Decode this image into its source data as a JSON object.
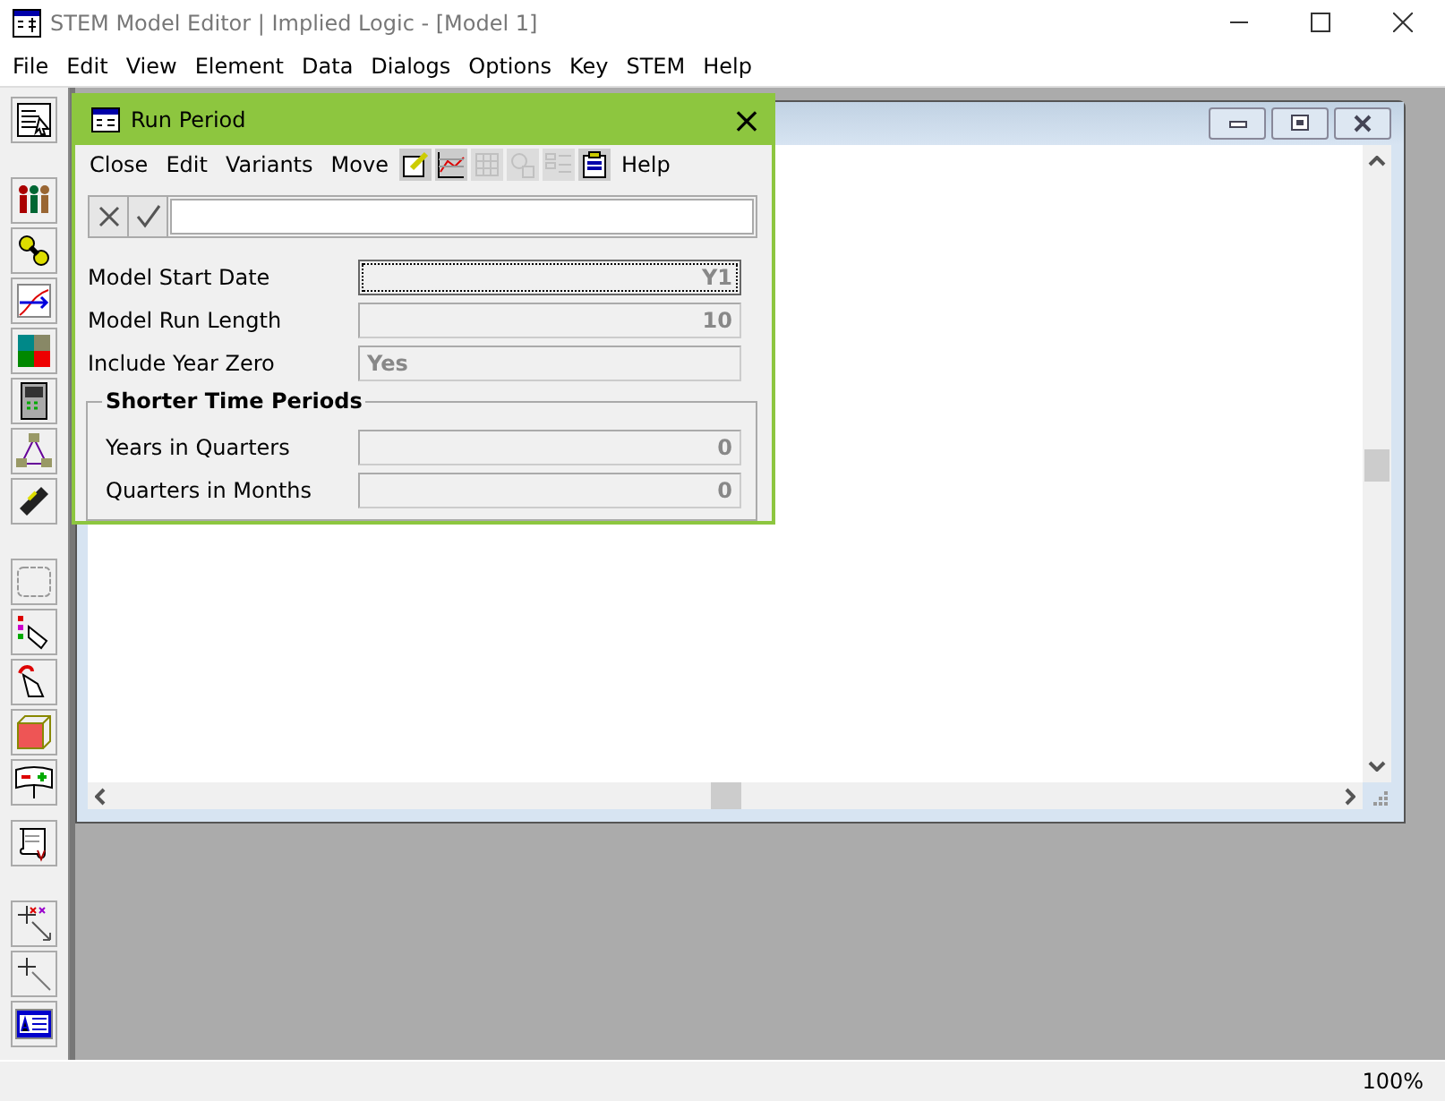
{
  "window": {
    "title": "STEM Model Editor | Implied Logic - [Model 1]"
  },
  "menu": [
    "File",
    "Edit",
    "View",
    "Element",
    "Data",
    "Dialogs",
    "Options",
    "Key",
    "STEM",
    "Help"
  ],
  "dialog": {
    "title": "Run Period",
    "close": "×",
    "menu": [
      "Close",
      "Edit",
      "Variants",
      "Move"
    ],
    "toolbar": [
      {
        "disabled": false
      },
      {
        "disabled": false
      },
      {
        "disabled": true
      },
      {
        "disabled": true
      },
      {
        "disabled": true
      },
      {
        "disabled": false
      }
    ],
    "help": "Help",
    "fields": [
      {
        "label": "Model Start Date",
        "value": "Y1",
        "kind": "number",
        "focused": true
      },
      {
        "label": "Model Run Length",
        "value": "10",
        "kind": "number",
        "focused": false
      },
      {
        "label": "Include Year Zero",
        "value": "Yes",
        "kind": "choice",
        "focused": false
      }
    ],
    "group": {
      "title": "Shorter Time Periods",
      "fields": [
        {
          "label": "Years in Quarters",
          "value": "0",
          "kind": "number",
          "focused": false
        },
        {
          "label": "Quarters in Months",
          "value": "0",
          "kind": "number",
          "focused": false
        }
      ]
    }
  },
  "status_bar": {
    "zoom": "100%"
  }
}
